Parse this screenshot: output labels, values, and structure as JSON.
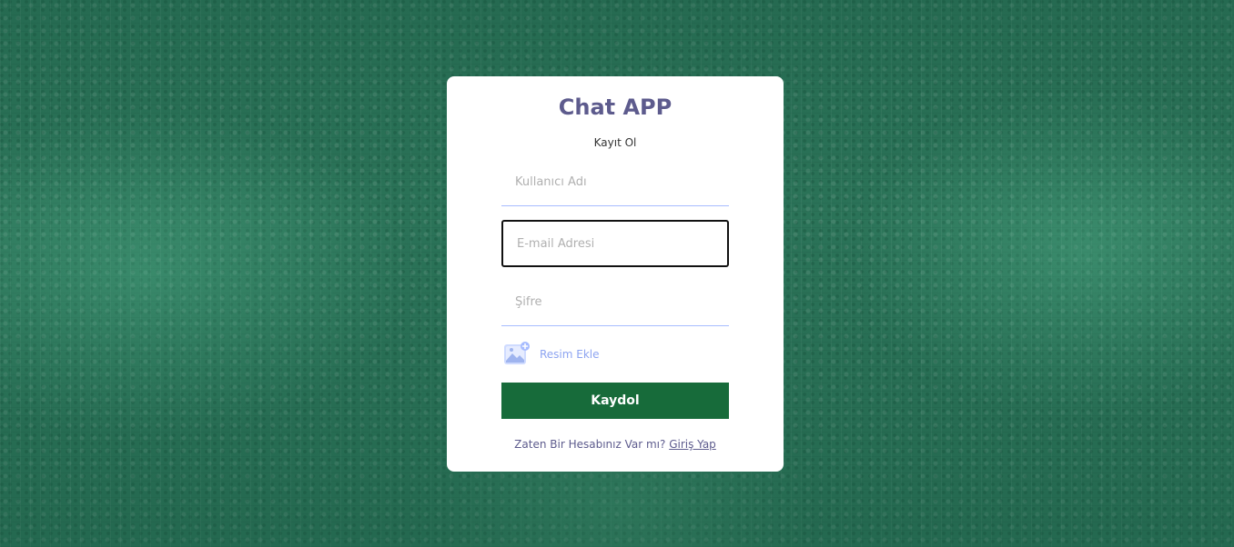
{
  "app": {
    "title": "Chat APP",
    "subtitle": "Kayıt Ol"
  },
  "form": {
    "username": {
      "placeholder": "Kullanıcı Adı",
      "value": ""
    },
    "email": {
      "placeholder": "E-mail Adresi",
      "value": ""
    },
    "password": {
      "placeholder": "Şifre",
      "value": ""
    },
    "avatar": {
      "label": "Resim Ekle",
      "icon": "add-image-icon"
    },
    "submit_label": "Kaydol"
  },
  "footer": {
    "text": "Zaten Bir Hesabınız Var mı?",
    "link_label": "Giriş Yap"
  },
  "colors": {
    "background": "#2b7358",
    "card": "#ffffff",
    "title": "#5d5b8d",
    "button": "#176b3a",
    "input_border": "#a7bcff",
    "avatar_label": "#8da4f1"
  }
}
